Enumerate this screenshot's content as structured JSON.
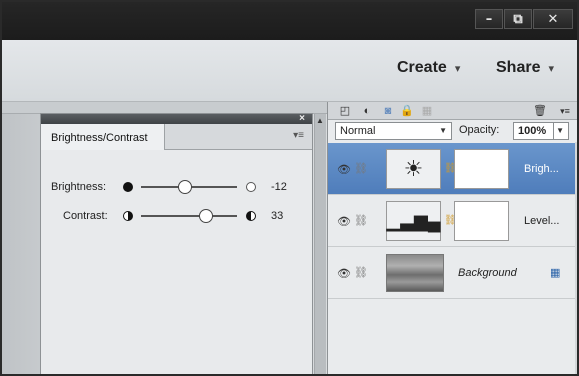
{
  "window": {
    "minimize_glyph": "–",
    "restore_glyph": "⧉",
    "close_glyph": "✕"
  },
  "actionbar": {
    "create_label": "Create",
    "share_label": "Share",
    "chevron": "▾"
  },
  "adjustment_panel": {
    "tab_label": "Brightness/Contrast",
    "close_glyph": "×",
    "menu_glyph": "▾≡",
    "brightness": {
      "label": "Brightness:",
      "value": "-12"
    },
    "contrast": {
      "label": "Contrast:",
      "value": "33"
    }
  },
  "layers_panel": {
    "blend_mode": "Normal",
    "opacity_label": "Opacity:",
    "opacity_value": "100%",
    "layers": [
      {
        "name": "Brigh...",
        "selected": true
      },
      {
        "name": "Level...",
        "selected": false
      },
      {
        "name": "Background",
        "selected": false
      }
    ]
  }
}
